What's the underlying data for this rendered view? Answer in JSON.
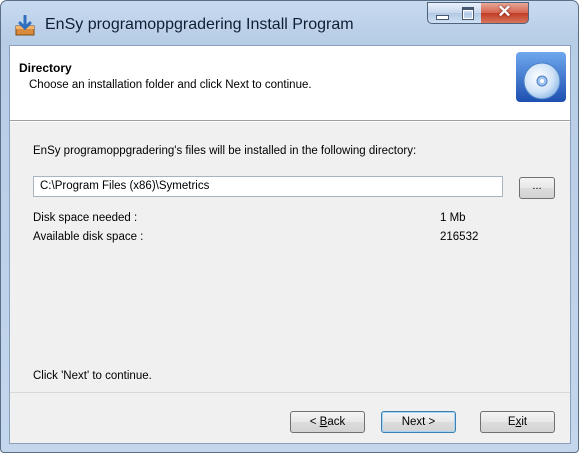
{
  "window": {
    "title": "EnSy programoppgradering Install Program"
  },
  "header": {
    "title": "Directory",
    "subtitle": "Choose an installation folder and click Next to continue."
  },
  "body": {
    "intro": "EnSy programoppgradering's files will be installed in the following directory:",
    "path_value": "C:\\Program Files (x86)\\Symetrics",
    "browse_label": "...",
    "disk_needed_label": "Disk space needed :",
    "disk_needed_value": "1 Mb",
    "available_label": "Available disk space :",
    "available_value": "216532",
    "footer_hint": "Click 'Next' to continue."
  },
  "buttons": {
    "back_prefix": "< ",
    "back_mnemonic": "B",
    "back_rest": "ack",
    "next_label": "Next >",
    "exit_prefix": "E",
    "exit_mnemonic": "x",
    "exit_rest": "it"
  },
  "colors": {
    "frame": "#b7cde6",
    "client": "#f0f0f0",
    "close": "#c03c26"
  }
}
